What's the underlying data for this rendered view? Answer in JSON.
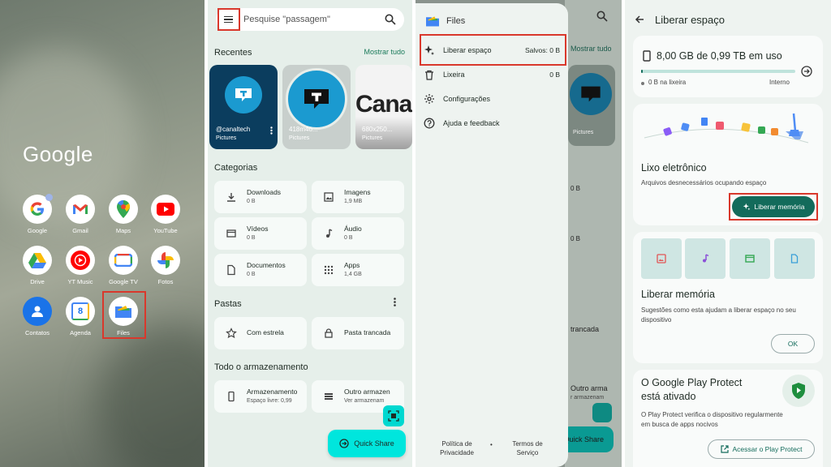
{
  "home": {
    "brand": "Google",
    "apps": [
      {
        "label": "Google",
        "icon": "google-g-icon"
      },
      {
        "label": "Gmail",
        "icon": "gmail-icon"
      },
      {
        "label": "Maps",
        "icon": "maps-pin-icon"
      },
      {
        "label": "YouTube",
        "icon": "youtube-icon"
      },
      {
        "label": "Drive",
        "icon": "drive-icon"
      },
      {
        "label": "YT Music",
        "icon": "yt-music-icon"
      },
      {
        "label": "Google TV",
        "icon": "google-tv-icon"
      },
      {
        "label": "Fotos",
        "icon": "photos-icon"
      },
      {
        "label": "Contatos",
        "icon": "contacts-icon"
      },
      {
        "label": "Agenda",
        "icon": "calendar-icon"
      },
      {
        "label": "Files",
        "icon": "files-icon"
      }
    ],
    "calendar_day": "8"
  },
  "files": {
    "search_placeholder": "Pesquise \"passagem\"",
    "recent_title": "Recentes",
    "show_all": "Mostrar tudo",
    "recent_items": [
      {
        "title": "@canaltech",
        "sub": "@canaltech",
        "tag": "Pictures"
      },
      {
        "title": "418m4o...",
        "tag": "Pictures"
      },
      {
        "title": "680x250...",
        "tag": "Pictures"
      }
    ],
    "thumb_canal_text": "Canal",
    "categories_title": "Categorias",
    "categories": [
      {
        "name": "Downloads",
        "size": "0 B"
      },
      {
        "name": "Imagens",
        "size": "1,9 MB"
      },
      {
        "name": "Vídeos",
        "size": "0 B"
      },
      {
        "name": "Áudio",
        "size": "0 B"
      },
      {
        "name": "Documentos",
        "size": "0 B"
      },
      {
        "name": "Apps",
        "size": "1,4 GB"
      }
    ],
    "folders_title": "Pastas",
    "folders": [
      "Com estrela",
      "Pasta trancada"
    ],
    "storage_title": "Todo o armazenamento",
    "storage": [
      {
        "name": "Armazenamento",
        "sub": "Espaço livre: 0,99"
      },
      {
        "name": "Outro armazen",
        "sub": "Ver armazenam"
      }
    ],
    "quick_share": "Quick Share"
  },
  "drawer": {
    "app_name": "Files",
    "items": [
      {
        "label": "Liberar espaço",
        "value": "Salvos: 0 B"
      },
      {
        "label": "Lixeira",
        "value": "0 B"
      },
      {
        "label": "Configurações",
        "value": ""
      },
      {
        "label": "Ajuda e feedback",
        "value": ""
      }
    ],
    "footer_privacy": "Política de Privacidade",
    "footer_dot": "•",
    "footer_terms": "Termos de Serviço",
    "behind": {
      "show_all": "Mostrar tudo",
      "tag": "Pictures",
      "sizes": [
        "0 B",
        "0 B"
      ],
      "folder": "trancada",
      "storage": "Outro arma",
      "storage_sub": "r armazenam",
      "quick_share": "Quick Share"
    }
  },
  "free_space": {
    "title": "Liberar espaço",
    "storage_used": "8,00 GB de 0,99 TB em uso",
    "trash_info": "0 B na lixeira",
    "storage_location": "Interno",
    "junk": {
      "title": "Lixo eletrônico",
      "desc": "Arquivos desnecessários ocupando espaço",
      "button": "Liberar memória"
    },
    "memory": {
      "title": "Liberar memória",
      "desc": "Sugestões como esta ajudam a liberar espaço no seu dispositivo",
      "ok": "OK"
    },
    "protect": {
      "title": "O Google Play Protect está ativado",
      "desc": "O Play Protect verifica o dispositivo regularmente em busca de apps nocivos",
      "button": "Acessar o Play Protect"
    },
    "progress_fraction": 0.008
  },
  "colors": {
    "highlight": "#d9382c",
    "accent_teal": "#136b5b",
    "quick_share": "#00e6dd"
  }
}
